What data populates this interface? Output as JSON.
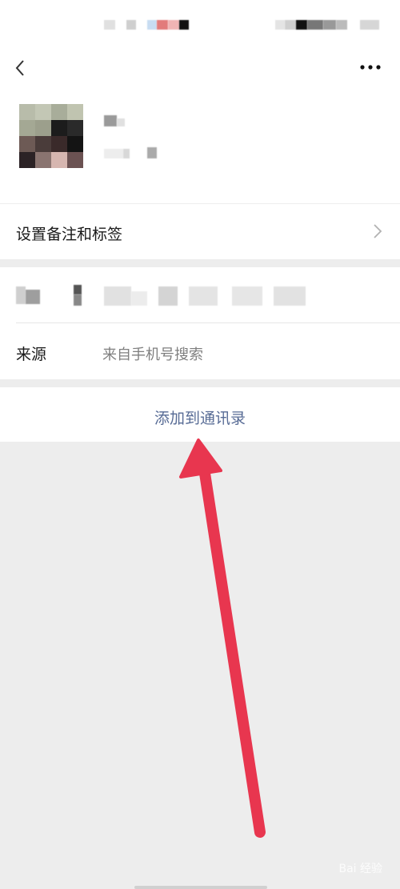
{
  "nav": {
    "back_icon": "chevron-left-icon",
    "more_icon": "ellipsis-icon"
  },
  "profile": {
    "avatar_icon": "pixelated-avatar-image"
  },
  "settings_row": {
    "label": "设置备注和标签",
    "chevron_icon": "chevron-right-icon"
  },
  "source_row": {
    "label": "来源",
    "value": "来自手机号搜索"
  },
  "action": {
    "label": "添加到通讯录"
  },
  "watermark": {
    "text": "Bai 经验"
  },
  "colors": {
    "link": "#576b95",
    "arrow": "#e8364f",
    "background": "#ededed"
  }
}
